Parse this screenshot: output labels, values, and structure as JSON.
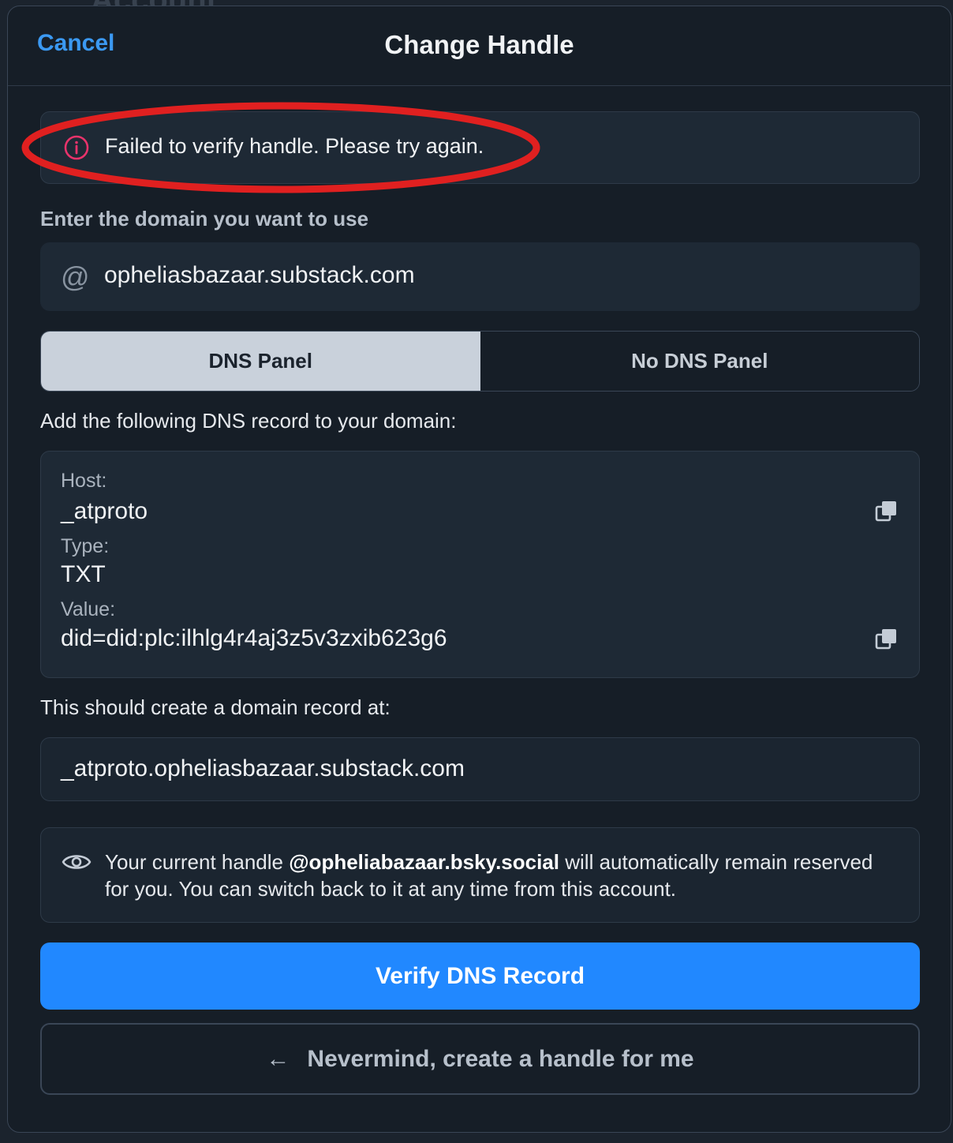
{
  "backdrop": {
    "title": "Account"
  },
  "header": {
    "cancel_label": "Cancel",
    "title": "Change Handle"
  },
  "error": {
    "message": "Failed to verify handle. Please try again.",
    "icon": "info-circle-icon",
    "color": "#e8336b",
    "annotation_color": "#e02020"
  },
  "domain": {
    "label": "Enter the domain you want to use",
    "value": "opheliasbazaar.substack.com",
    "icon": "at-icon"
  },
  "tabs": [
    {
      "label": "DNS Panel",
      "active": true
    },
    {
      "label": "No DNS Panel",
      "active": false
    }
  ],
  "record": {
    "intro": "Add the following DNS record to your domain:",
    "host_label": "Host:",
    "host_value": "_atproto",
    "type_label": "Type:",
    "type_value": "TXT",
    "value_label": "Value:",
    "value_value": "did=did:plc:ilhlg4r4aj3z5v3zxib623g6"
  },
  "fqdn": {
    "label": "This should create a domain record at:",
    "value": "_atproto.opheliasbazaar.substack.com"
  },
  "note": {
    "prefix": "Your current handle ",
    "handle": "@opheliabazaar.bsky.social",
    "suffix": " will automatically remain reserved for you. You can switch back to it at any time from this account.",
    "icon": "eye-icon"
  },
  "actions": {
    "verify_label": "Verify DNS Record",
    "nevermind_label": "Nevermind, create a handle for me",
    "accent": "#2188ff"
  }
}
